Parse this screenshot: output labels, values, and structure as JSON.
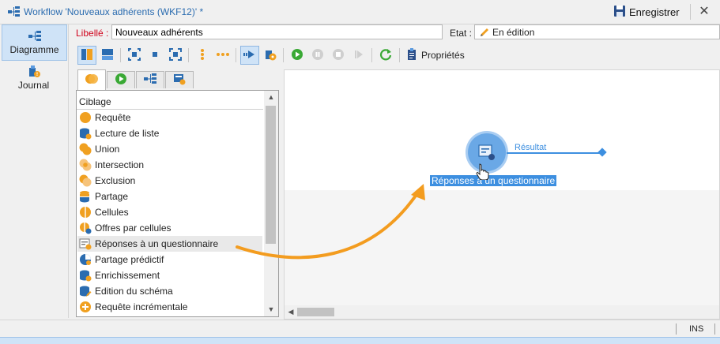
{
  "window": {
    "title": "Workflow 'Nouveaux adhérents (WKF12)' *",
    "save_label": "Enregistrer",
    "close_glyph": "✕"
  },
  "nav": {
    "items": [
      {
        "label": "Diagramme",
        "icon": "workflow-diagram-icon",
        "active": true
      },
      {
        "label": "Journal",
        "icon": "journal-icon",
        "active": false
      }
    ]
  },
  "form": {
    "libelle_label": "Libellé :",
    "libelle_value": "Nouveaux adhérents",
    "etat_label": "Etat :",
    "etat_value": "En édition"
  },
  "toolbar": {
    "properties_label": "Propriétés"
  },
  "palette": {
    "tabs": [
      "targeting-tab",
      "flow-control-tab",
      "actions-tab",
      "events-tab"
    ],
    "header": "Ciblage",
    "items": [
      {
        "label": "Requête",
        "icon": "query-icon"
      },
      {
        "label": "Lecture de liste",
        "icon": "read-list-icon"
      },
      {
        "label": "Union",
        "icon": "union-icon"
      },
      {
        "label": "Intersection",
        "icon": "intersection-icon"
      },
      {
        "label": "Exclusion",
        "icon": "exclusion-icon"
      },
      {
        "label": "Partage",
        "icon": "split-icon"
      },
      {
        "label": "Cellules",
        "icon": "cells-icon"
      },
      {
        "label": "Offres par cellules",
        "icon": "offers-by-cell-icon"
      },
      {
        "label": "Réponses à un questionnaire",
        "icon": "survey-responses-icon",
        "highlighted": true
      },
      {
        "label": "Partage prédictif",
        "icon": "predictive-split-icon"
      },
      {
        "label": "Enrichissement",
        "icon": "enrichment-icon"
      },
      {
        "label": "Edition du schéma",
        "icon": "schema-edit-icon"
      },
      {
        "label": "Requête incrémentale",
        "icon": "incremental-query-icon"
      }
    ]
  },
  "canvas": {
    "activity_label": "Réponses à un questionnaire",
    "transition_label": "Résultat"
  },
  "status": {
    "ins": "INS"
  },
  "colors": {
    "accent": "#3d8fe0",
    "required_label": "#d0021b",
    "arrow": "#f39c1f",
    "orange_icon": "#f0a020"
  }
}
